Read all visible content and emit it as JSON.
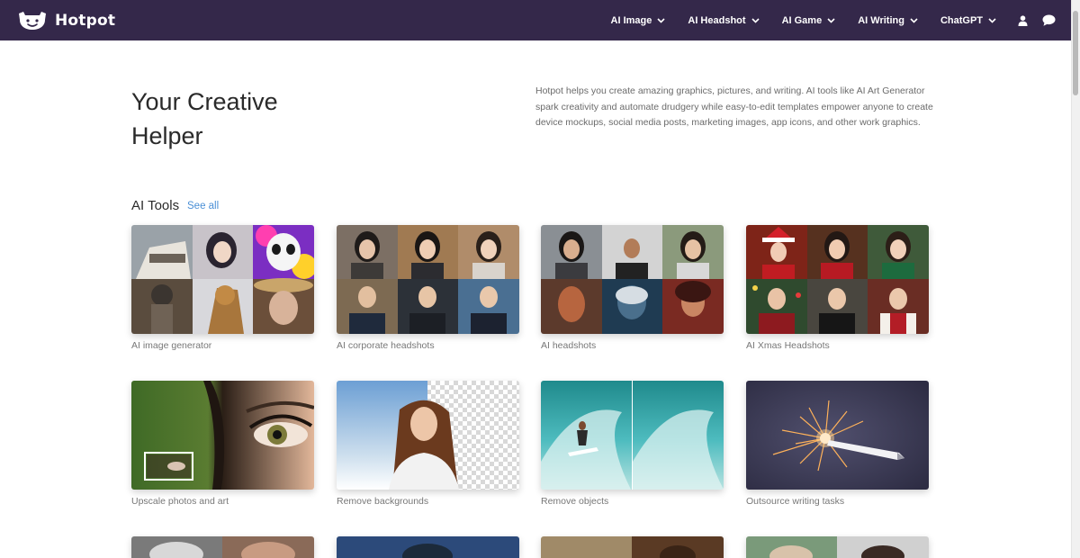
{
  "header": {
    "brand": "Hotpot",
    "nav": [
      {
        "label": "AI Image"
      },
      {
        "label": "AI Headshot"
      },
      {
        "label": "AI Game"
      },
      {
        "label": "AI Writing"
      },
      {
        "label": "ChatGPT"
      }
    ],
    "icons": [
      "user-icon",
      "chat-icon"
    ]
  },
  "hero": {
    "title_line1": "Your Creative",
    "title_line2": "Helper",
    "description": "Hotpot helps you create amazing graphics, pictures, and writing. AI tools like AI Art Generator spark creativity and automate drudgery while easy-to-edit templates empower anyone to create device mockups, social media posts, marketing images, app icons, and other work graphics."
  },
  "tools": {
    "title": "AI Tools",
    "see_all": "See all",
    "cards": [
      {
        "caption": "AI image generator"
      },
      {
        "caption": "AI corporate headshots"
      },
      {
        "caption": "AI headshots"
      },
      {
        "caption": "AI Xmas Headshots"
      },
      {
        "caption": "Upscale photos and art"
      },
      {
        "caption": "Remove backgrounds"
      },
      {
        "caption": "Remove objects"
      },
      {
        "caption": "Outsource writing tasks"
      }
    ]
  },
  "colors": {
    "header_bg": "#34284a",
    "link": "#4a8fd6",
    "caption": "#777777"
  }
}
